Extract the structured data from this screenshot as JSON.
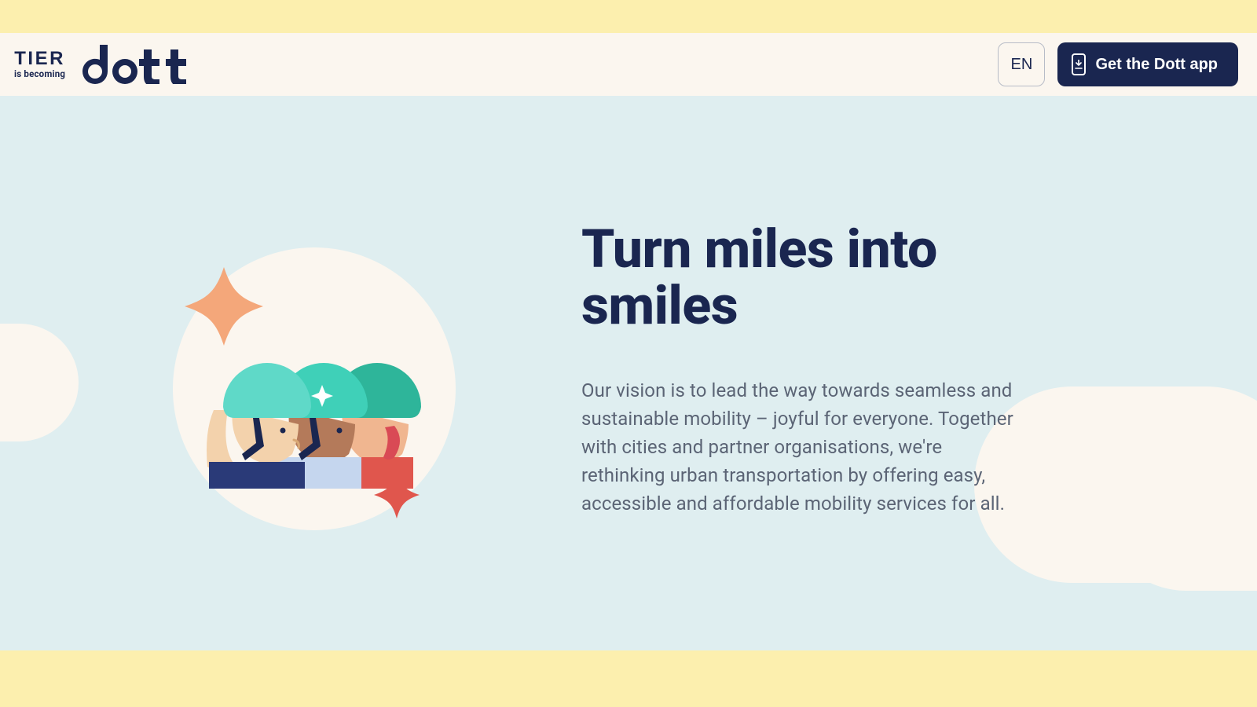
{
  "header": {
    "tier_label": "TIER",
    "tier_sub": "is becoming",
    "brand": "dott",
    "lang": "EN",
    "cta": "Get the Dott app"
  },
  "hero": {
    "headline": "Turn miles into smiles",
    "body": "Our vision is to lead the way towards seamless and sustainable mobility – joyful for everyone. Together with cities and partner organisations, we're rethinking urban transportation by offering easy, accessible and affordable mobility services for all."
  },
  "colors": {
    "yellow": "#fcefae",
    "cream": "#fbf6ef",
    "mint": "#dfeef0",
    "navy": "#1a2650"
  }
}
